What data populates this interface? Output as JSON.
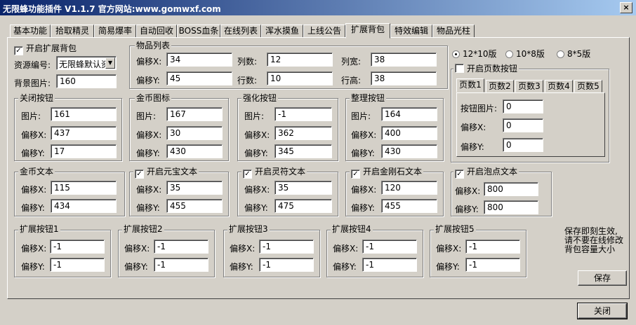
{
  "window": {
    "title": "无限蜂功能插件 V1.1.7 官方网站:www.gomwxf.com",
    "close_glyph": "×"
  },
  "tabs": [
    "基本功能",
    "拾取精灵",
    "简易爆率",
    "自动回收",
    "BOSS血条",
    "在线列表",
    "浑水摸鱼",
    "上线公告",
    "扩展背包",
    "特效编辑",
    "物品光柱"
  ],
  "active_tab": "扩展背包",
  "general": {
    "enable_label": "开启扩展背包",
    "enable_checked": true,
    "resource_label": "资源编号:",
    "resource_value": "无限蜂默认资源",
    "bg_label": "背景图片:",
    "bg_value": "160"
  },
  "item_list": {
    "title": "物品列表",
    "offset_x_label": "偏移X:",
    "offset_x": "34",
    "offset_y_label": "偏移Y:",
    "offset_y": "45",
    "cols_label": "列数:",
    "cols": "12",
    "rows_label": "行数:",
    "rows": "10",
    "col_w_label": "列宽:",
    "col_w": "38",
    "row_h_label": "行高:",
    "row_h": "38"
  },
  "close_btn_group": {
    "title": "关闭按钮",
    "pic_label": "图片:",
    "pic": "161",
    "x_label": "偏移X:",
    "x": "437",
    "y_label": "偏移Y:",
    "y": "17"
  },
  "gold_icon_group": {
    "title": "金币图标",
    "pic_label": "图片:",
    "pic": "167",
    "x_label": "偏移X:",
    "x": "30",
    "y_label": "偏移Y:",
    "y": "430"
  },
  "enhance_btn_group": {
    "title": "强化按钮",
    "pic_label": "图片:",
    "pic": "-1",
    "x_label": "偏移X:",
    "x": "362",
    "y_label": "偏移Y:",
    "y": "345"
  },
  "sort_btn_group": {
    "title": "整理按钮",
    "pic_label": "图片:",
    "pic": "164",
    "x_label": "偏移X:",
    "x": "400",
    "y_label": "偏移Y:",
    "y": "430"
  },
  "gold_text": {
    "title": "金币文本",
    "x_label": "偏移X:",
    "x": "115",
    "y_label": "偏移Y:",
    "y": "434"
  },
  "yuanbao_text": {
    "title": "开启元宝文本",
    "checked": true,
    "x_label": "偏移X:",
    "x": "35",
    "y_label": "偏移Y:",
    "y": "455"
  },
  "lingfu_text": {
    "title": "开启灵符文本",
    "checked": true,
    "x_label": "偏移X:",
    "x": "35",
    "y_label": "偏移Y:",
    "y": "475"
  },
  "diamond_text": {
    "title": "开启金刚石文本",
    "checked": true,
    "x_label": "偏移X:",
    "x": "120",
    "y_label": "偏移Y:",
    "y": "455"
  },
  "bubble_text": {
    "title": "开启泡点文本",
    "checked": true,
    "x_label": "偏移X:",
    "x": "800",
    "y_label": "偏移Y:",
    "y": "800"
  },
  "layout_options": {
    "options": [
      "12*10版",
      "10*8版",
      "8*5版"
    ],
    "selected": "12*10版"
  },
  "page_buttons": {
    "title": "开启页数按钮",
    "checked": false,
    "tabs": [
      "页数1",
      "页数2",
      "页数3",
      "页数4",
      "页数5"
    ],
    "active": "页数1",
    "pic_label": "按钮图片:",
    "pic": "0",
    "x_label": "偏移X:",
    "x": "0",
    "y_label": "偏移Y:",
    "y": "0"
  },
  "ext_buttons": [
    {
      "title": "扩展按钮1",
      "x_label": "偏移X:",
      "x": "-1",
      "y_label": "偏移Y:",
      "y": "-1"
    },
    {
      "title": "扩展按钮2",
      "x_label": "偏移X:",
      "x": "-1",
      "y_label": "偏移Y:",
      "y": "-1"
    },
    {
      "title": "扩展按钮3",
      "x_label": "偏移X:",
      "x": "-1",
      "y_label": "偏移Y:",
      "y": "-1"
    },
    {
      "title": "扩展按钮4",
      "x_label": "偏移X:",
      "x": "-1",
      "y_label": "偏移Y:",
      "y": "-1"
    },
    {
      "title": "扩展按钮5",
      "x_label": "偏移X:",
      "x": "-1",
      "y_label": "偏移Y:",
      "y": "-1"
    }
  ],
  "note": "保存即刻生效,\n请不要在线修改\n背包容量大小",
  "save_label": "保存",
  "close_label": "关闭",
  "check_glyph": "✓",
  "combo_arrow": "▼"
}
